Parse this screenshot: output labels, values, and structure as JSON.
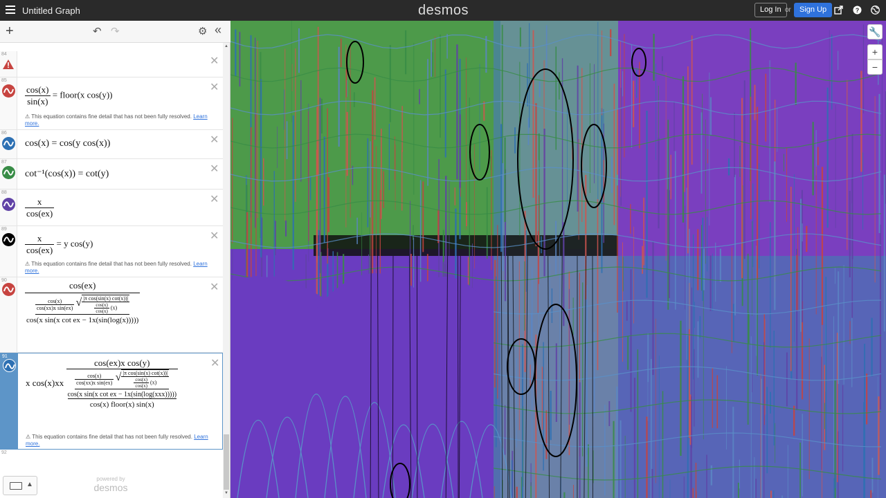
{
  "topbar": {
    "title": "Untitled Graph",
    "logo": "desmos",
    "login_label": "Log In",
    "or_label": "or",
    "signup_label": "Sign Up",
    "icons": [
      "hamburger-icon",
      "share-icon",
      "help-icon",
      "globe-icon"
    ]
  },
  "panel": {
    "icons": [
      "add-icon",
      "undo-icon",
      "redo-icon",
      "gear-icon",
      "collapse-icon"
    ],
    "expressions": [
      {
        "num": "84",
        "color": "#c74440",
        "warning": true
      },
      {
        "num": "85",
        "color": "#c74440",
        "note": "This equation contains fine detail that has not been fully resolved.",
        "link": "Learn more."
      },
      {
        "num": "86",
        "color": "#2d70b3"
      },
      {
        "num": "87",
        "color": "#388c46"
      },
      {
        "num": "88",
        "color": "#6042a6"
      },
      {
        "num": "89",
        "color": "#000000",
        "note": "This equation contains fine detail that has not been fully resolved.",
        "link": "Learn more."
      },
      {
        "num": "90",
        "color": "#c74440"
      },
      {
        "num": "91",
        "color": "#2d70b3",
        "note": "This equation contains fine detail that has not been fully resolved.",
        "link": "Learn more."
      },
      {
        "num": "92"
      }
    ],
    "math": {
      "e85_num": "cos(x)",
      "e85_den": "sin(x)",
      "e85_rhs": "= floor(x cos(y))",
      "e86": "cos(x) = cos(y cos(x))",
      "e87": "cot⁻¹(cos(x)) = cot(y)",
      "e88_num": "x",
      "e88_den": "cos(ex)",
      "e89_num": "x",
      "e89_den": "cos(ex)",
      "e89_rhs": "= y cos(y)",
      "e90_top": "cos(ex)",
      "e90_a_num": "cos(x)",
      "e90_a_den": "cos(xx)x sin(ex)",
      "e90_sqrt": "|π cos(sin(x) cot(x))|",
      "e90_b_num": "cos(x)",
      "e90_b_den": "cos(x)",
      "e90_b_tail": "(x)",
      "e90_bottom": "cos(x sin(x cot ex − 1x(sin(log(x)))))",
      "e91_lead": "x cos(x)xx",
      "e91_top": "cos(ex)x cos(y)",
      "e91_a_num": "cos(x)",
      "e91_a_den": "cos(xx)x sin(ex)",
      "e91_sqrt": "|π cos(sin(x) cot(x))|",
      "e91_b_num": "cos(x)",
      "e91_b_den": "cos(x)",
      "e91_b_tail": "(x)",
      "e91_mid": "cos(x sin(x cot ex − 1x(sin(log(xxx)))))",
      "e91_bottom": "cos(x) floor(x) sin(x)"
    }
  },
  "footer": {
    "powered_by": "powered by",
    "brand": "desmos"
  },
  "graph_controls": {
    "wrench": "🔧",
    "zoom_in": "+",
    "zoom_out": "−"
  },
  "colors": {
    "red": "#c74440",
    "blue": "#2d70b3",
    "green": "#388c46",
    "purple": "#6042a6",
    "black": "#000000",
    "selection": "#5d95c8",
    "signup": "#2f72dc"
  }
}
